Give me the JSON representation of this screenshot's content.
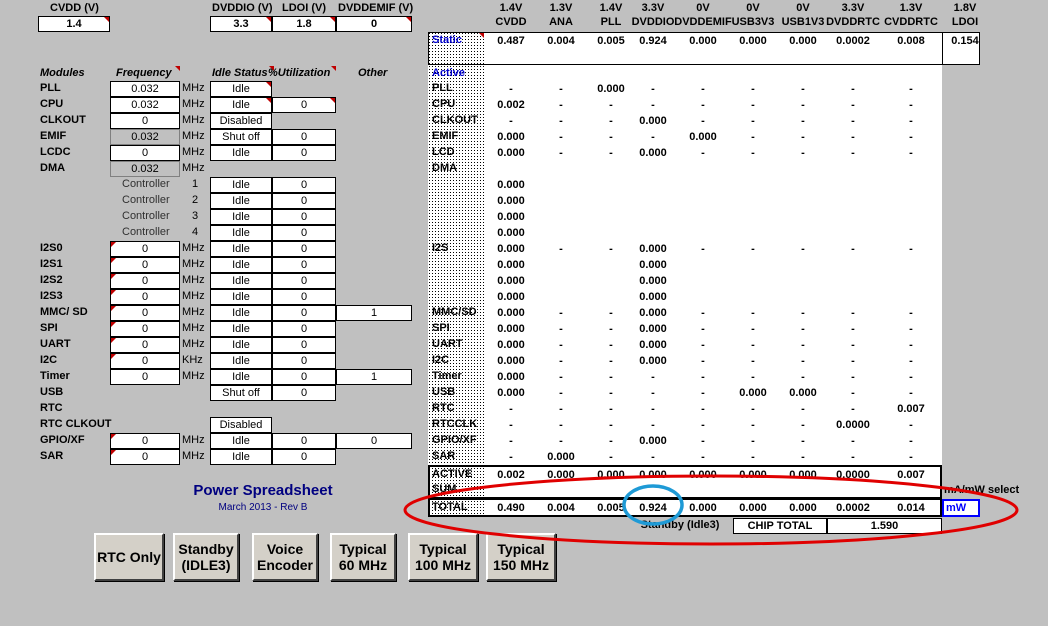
{
  "top": {
    "cvdd_label": "CVDD (V)",
    "cvdd_value": "1.4",
    "dvddio_label": "DVDDIO (V)",
    "dvddio_value": "3.3",
    "ldoi_label": "LDOI (V)",
    "ldoi_value": "1.8",
    "dvddemif_label": "DVDDEMIF (V)",
    "dvddemif_value": "0"
  },
  "headers": {
    "modules": "Modules",
    "frequency": "Frequency",
    "idle_status": "Idle Status",
    "utilization": "%Utilization",
    "other": "Other"
  },
  "rows": [
    {
      "name": "PLL",
      "freq": "0.032",
      "unit": "MHz",
      "status": "Idle",
      "util": "",
      "other": ""
    },
    {
      "name": "CPU",
      "freq": "0.032",
      "unit": "MHz",
      "status": "Idle",
      "util": "0",
      "other": ""
    },
    {
      "name": "CLKOUT",
      "freq": "0",
      "unit": "MHz",
      "status": "Disabled",
      "util": "",
      "other": ""
    },
    {
      "name": "EMIF",
      "freq": "0.032",
      "unit": "MHz",
      "status": "Shut off",
      "util": "0",
      "other": ""
    },
    {
      "name": "LCDC",
      "freq": "0",
      "unit": "MHz",
      "status": "Idle",
      "util": "0",
      "other": ""
    },
    {
      "name": "DMA",
      "freq": "0.032",
      "unit": "MHz",
      "status": "",
      "util": "",
      "other": ""
    },
    {
      "name": "",
      "ctrl": "Controller",
      "num": "1",
      "status": "Idle",
      "util": "0",
      "other": ""
    },
    {
      "name": "",
      "ctrl": "Controller",
      "num": "2",
      "status": "Idle",
      "util": "0",
      "other": ""
    },
    {
      "name": "",
      "ctrl": "Controller",
      "num": "3",
      "status": "Idle",
      "util": "0",
      "other": ""
    },
    {
      "name": "",
      "ctrl": "Controller",
      "num": "4",
      "status": "Idle",
      "util": "0",
      "other": ""
    },
    {
      "name": "I2S0",
      "freq": "0",
      "unit": "MHz",
      "status": "Idle",
      "util": "0",
      "other": ""
    },
    {
      "name": "I2S1",
      "freq": "0",
      "unit": "MHz",
      "status": "Idle",
      "util": "0",
      "other": ""
    },
    {
      "name": "I2S2",
      "freq": "0",
      "unit": "MHz",
      "status": "Idle",
      "util": "0",
      "other": ""
    },
    {
      "name": "I2S3",
      "freq": "0",
      "unit": "MHz",
      "status": "Idle",
      "util": "0",
      "other": ""
    },
    {
      "name": "MMC/ SD",
      "freq": "0",
      "unit": "MHz",
      "status": "Idle",
      "util": "0",
      "other": "1"
    },
    {
      "name": "SPI",
      "freq": "0",
      "unit": "MHz",
      "status": "Idle",
      "util": "0",
      "other": ""
    },
    {
      "name": "UART",
      "freq": "0",
      "unit": "MHz",
      "status": "Idle",
      "util": "0",
      "other": ""
    },
    {
      "name": "I2C",
      "freq": "0",
      "unit": "KHz",
      "status": "Idle",
      "util": "0",
      "other": ""
    },
    {
      "name": "Timer",
      "freq": "0",
      "unit": "MHz",
      "status": "Idle",
      "util": "0",
      "other": "1"
    },
    {
      "name": "USB",
      "freq": "",
      "unit": "",
      "status": "Shut off",
      "util": "0",
      "other": ""
    },
    {
      "name": "RTC",
      "freq": "",
      "unit": "",
      "status": "",
      "util": "",
      "other": ""
    },
    {
      "name": "RTC CLKOUT",
      "freq": "",
      "unit": "",
      "status": "Disabled",
      "util": "",
      "other": ""
    },
    {
      "name": "GPIO/XF",
      "freq": "0",
      "unit": "MHz",
      "status": "Idle",
      "util": "0",
      "other": "0"
    },
    {
      "name": "SAR",
      "freq": "0",
      "unit": "MHz",
      "status": "Idle",
      "util": "0",
      "other": ""
    }
  ],
  "power_title": "Power  Spreadsheet",
  "power_subtitle": "March 2013   -   Rev B",
  "buttons": [
    "RTC Only",
    "Standby\n(IDLE3)",
    "Voice\nEncoder",
    "Typical\n60 MHz",
    "Typical\n100 MHz",
    "Typical\n150 MHz"
  ],
  "columns": [
    {
      "v": "1.4V",
      "n": "CVDD"
    },
    {
      "v": "1.3V",
      "n": "ANA"
    },
    {
      "v": "1.4V",
      "n": "PLL"
    },
    {
      "v": "3.3V",
      "n": "DVDDIO"
    },
    {
      "v": "0V",
      "n": "DVDDEMIF"
    },
    {
      "v": "0V",
      "n": "USB3V3"
    },
    {
      "v": "0V",
      "n": "USB1V3"
    },
    {
      "v": "3.3V",
      "n": "DVDDRTC"
    },
    {
      "v": "1.3V",
      "n": "CVDDRTC"
    },
    {
      "v": "1.8V",
      "n": "LDOI"
    }
  ],
  "static_label": "Static",
  "static_values": [
    "0.487",
    "0.004",
    "0.005",
    "0.924",
    "0.000",
    "0.000",
    "0.000",
    "0.0002",
    "0.008",
    "0.154"
  ],
  "active_label": "Active",
  "matrix": [
    {
      "name": "PLL",
      "v": [
        "-",
        "-",
        "0.000",
        "-",
        "-",
        "-",
        "-",
        "-",
        "-"
      ]
    },
    {
      "name": "CPU",
      "v": [
        "0.002",
        "-",
        "-",
        "-",
        "-",
        "-",
        "-",
        "-",
        "-"
      ]
    },
    {
      "name": "CLKOUT",
      "v": [
        "-",
        "-",
        "-",
        "0.000",
        "-",
        "-",
        "-",
        "-",
        "-"
      ]
    },
    {
      "name": "EMIF",
      "v": [
        "0.000",
        "-",
        "-",
        "-",
        "0.000",
        "-",
        "-",
        "-",
        "-"
      ]
    },
    {
      "name": "LCD",
      "v": [
        "0.000",
        "-",
        "-",
        "0.000",
        "-",
        "-",
        "-",
        "-",
        "-"
      ]
    },
    {
      "name": "DMA",
      "v": [
        "",
        "",
        "",
        "",
        "",
        "",
        "",
        "",
        ""
      ]
    },
    {
      "name": "",
      "v": [
        "0.000",
        "",
        "",
        "",
        "",
        "",
        "",
        "",
        ""
      ]
    },
    {
      "name": "",
      "v": [
        "0.000",
        "",
        "",
        "",
        "",
        "",
        "",
        "",
        ""
      ]
    },
    {
      "name": "",
      "v": [
        "0.000",
        "",
        "",
        "",
        "",
        "",
        "",
        "",
        ""
      ]
    },
    {
      "name": "",
      "v": [
        "0.000",
        "",
        "",
        "",
        "",
        "",
        "",
        "",
        ""
      ]
    },
    {
      "name": "I2S",
      "v": [
        "0.000",
        "-",
        "-",
        "0.000",
        "-",
        "-",
        "-",
        "-",
        "-"
      ]
    },
    {
      "name": "",
      "v": [
        "0.000",
        "",
        "",
        "0.000",
        "",
        "",
        "",
        "",
        ""
      ]
    },
    {
      "name": "",
      "v": [
        "0.000",
        "",
        "",
        "0.000",
        "",
        "",
        "",
        "",
        ""
      ]
    },
    {
      "name": "",
      "v": [
        "0.000",
        "",
        "",
        "0.000",
        "",
        "",
        "",
        "",
        ""
      ]
    },
    {
      "name": "MMC/SD",
      "v": [
        "0.000",
        "-",
        "-",
        "0.000",
        "-",
        "-",
        "-",
        "-",
        "-"
      ]
    },
    {
      "name": "SPI",
      "v": [
        "0.000",
        "-",
        "-",
        "0.000",
        "-",
        "-",
        "-",
        "-",
        "-"
      ]
    },
    {
      "name": "UART",
      "v": [
        "0.000",
        "-",
        "-",
        "0.000",
        "-",
        "-",
        "-",
        "-",
        "-"
      ]
    },
    {
      "name": "I2C",
      "v": [
        "0.000",
        "-",
        "-",
        "0.000",
        "-",
        "-",
        "-",
        "-",
        "-"
      ]
    },
    {
      "name": "Timer",
      "v": [
        "0.000",
        "-",
        "-",
        "-",
        "-",
        "-",
        "-",
        "-",
        "-"
      ]
    },
    {
      "name": "USB",
      "v": [
        "0.000",
        "-",
        "-",
        "-",
        "-",
        "0.000",
        "0.000",
        "-",
        "-"
      ]
    },
    {
      "name": "RTC",
      "v": [
        "-",
        "-",
        "-",
        "-",
        "-",
        "-",
        "-",
        "-",
        "0.007"
      ]
    },
    {
      "name": "RTCCLK",
      "v": [
        "-",
        "-",
        "-",
        "-",
        "-",
        "-",
        "-",
        "0.0000",
        "-"
      ]
    },
    {
      "name": "GPIO/XF",
      "v": [
        "-",
        "-",
        "-",
        "0.000",
        "-",
        "-",
        "-",
        "-",
        "-"
      ]
    },
    {
      "name": "SAR",
      "v": [
        "-",
        "0.000",
        "-",
        "-",
        "-",
        "-",
        "-",
        "-",
        "-"
      ]
    }
  ],
  "active_sum_label": "ACTIVE\nSUM",
  "active_sum": [
    "0.002",
    "0.000",
    "0.000",
    "0.000",
    "0.000",
    "0.000",
    "0.000",
    "0.0000",
    "0.007"
  ],
  "total_label": "TOTAL",
  "total_values": [
    "0.490",
    "0.004",
    "0.005",
    "0.924",
    "0.000",
    "0.000",
    "0.000",
    "0.0002",
    "0.014"
  ],
  "select_label": "mA/mW select",
  "select_value": "mW",
  "mode_label": "Standby (Idle3)",
  "chip_total_label": "CHIP TOTAL",
  "chip_total_value": "1.590",
  "colors": {
    "background": "#c0c0c0",
    "annotation_ring": "#e00000",
    "highlight_circle": "#1e9ad6",
    "title": "#000080",
    "static_label": "#0000cc",
    "select_border": "#0000ff"
  }
}
